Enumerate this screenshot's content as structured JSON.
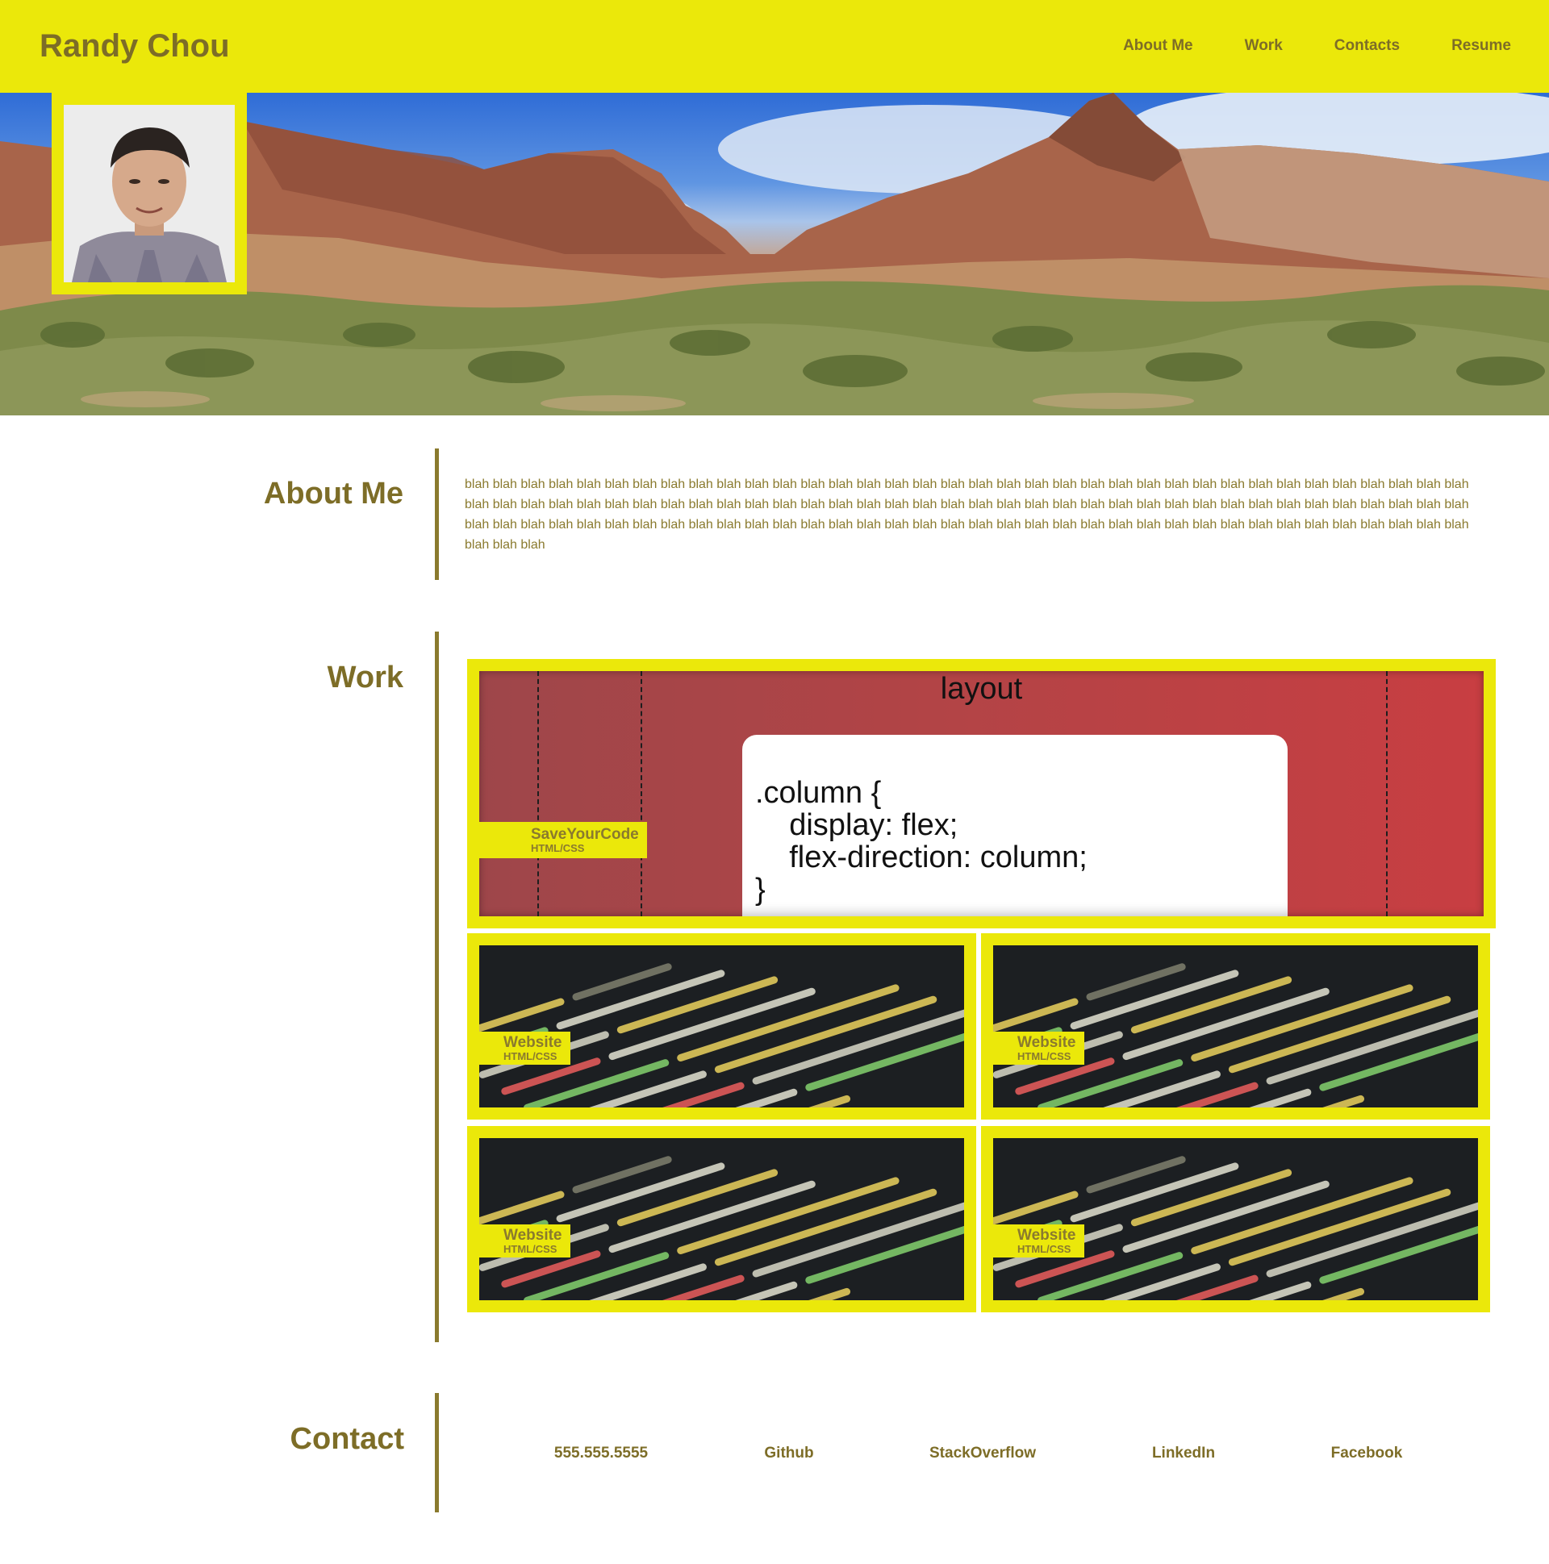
{
  "header": {
    "brand": "Randy Chou",
    "nav": [
      "About Me",
      "Work",
      "Contacts",
      "Resume"
    ]
  },
  "about": {
    "title": "About Me",
    "text": "blah blah blah blah blah blah blah blah blah blah blah blah blah blah blah blah blah blah blah blah blah blah blah blah blah blah blah blah blah blah blah blah blah blah blah blah blah blah blah blah blah blah blah blah blah blah blah blah blah blah blah blah blah blah blah blah blah blah blah blah blah blah blah blah blah blah blah blah blah blah blah blah blah blah blah blah blah blah blah blah blah blah blah blah blah blah blah blah blah blah blah blah blah blah blah blah blah blah blah blah blah blah blah blah blah blah blah blah blah blah blah"
  },
  "work": {
    "title": "Work",
    "featured": {
      "image_label": "layout",
      "code_lines": [
        ".column {",
        "    display: flex;",
        "    flex-direction: column;",
        "}"
      ],
      "name": "SaveYourCode",
      "tech": "HTML/CSS"
    },
    "projects": [
      {
        "name": "Website",
        "tech": "HTML/CSS"
      },
      {
        "name": "Website",
        "tech": "HTML/CSS"
      },
      {
        "name": "Website",
        "tech": "HTML/CSS"
      },
      {
        "name": "Website",
        "tech": "HTML/CSS"
      }
    ]
  },
  "contact": {
    "title": "Contact",
    "links": [
      "555.555.5555",
      "Github",
      "StackOverflow",
      "LinkedIn",
      "Facebook"
    ]
  },
  "colors": {
    "accent_yellow": "#ebe80a",
    "text_olive": "#7d6d27",
    "rule": "#8a7a2e",
    "featured_red": "#b24446"
  }
}
